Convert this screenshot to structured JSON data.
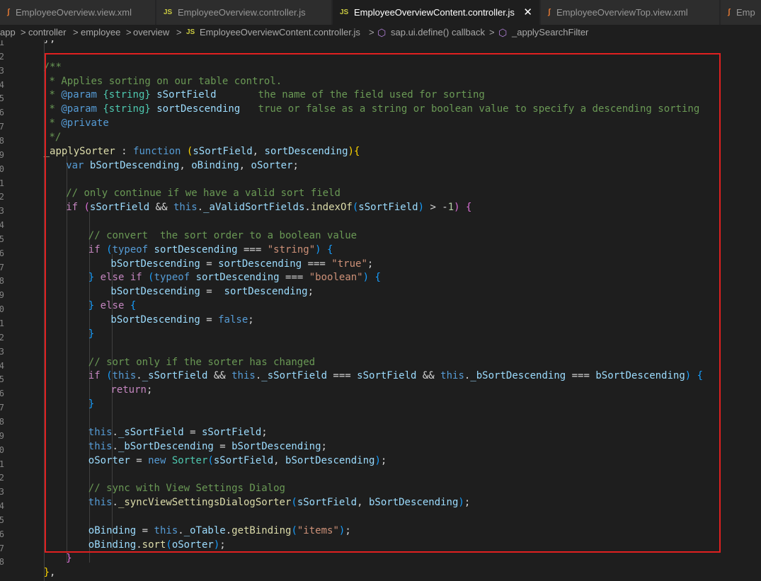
{
  "tabs": [
    {
      "icon": "xml-file-icon",
      "icon_glyph": "ʃ",
      "label": "EmployeeOverview.view.xml",
      "active": false
    },
    {
      "icon": "js-file-icon",
      "icon_glyph": "JS",
      "label": "EmployeeOverview.controller.js",
      "active": false
    },
    {
      "icon": "js-file-icon",
      "icon_glyph": "JS",
      "label": "EmployeeOverviewContent.controller.js",
      "active": true,
      "close": "✕"
    },
    {
      "icon": "xml-file-icon",
      "icon_glyph": "ʃ",
      "label": "EmployeeOverviewTop.view.xml",
      "active": false
    },
    {
      "icon": "xml-file-icon",
      "icon_glyph": "ʃ",
      "label": "Emp",
      "active": false
    }
  ],
  "breadcrumb": {
    "items": [
      "app",
      "controller",
      "employee",
      "overview"
    ],
    "file_badge": "JS",
    "file": "EmployeeOverviewContent.controller.js",
    "scope1": "sap.ui.define() callback",
    "scope2": "_applySearchFilter",
    "separator": ">"
  },
  "gutter": [
    "1",
    "2",
    "3",
    "4",
    "5",
    "6",
    "7",
    "8",
    "9",
    "0",
    "1",
    "2",
    "3",
    "4",
    "5",
    "6",
    "7",
    "8",
    "9",
    "0",
    "1",
    "2",
    "3",
    "4",
    "5",
    "6",
    "7",
    "8",
    "9",
    "0",
    "1",
    "2",
    "3",
    "4",
    "5",
    "6",
    "7",
    "8"
  ],
  "code_lines": [
    {
      "indent": "    ",
      "tokens": [
        [
          "p",
          "};"
        ]
      ]
    },
    {
      "indent": "",
      "tokens": []
    },
    {
      "indent": "    ",
      "tokens": [
        [
          "c",
          "/**"
        ]
      ]
    },
    {
      "indent": "     ",
      "tokens": [
        [
          "c",
          "* Applies sorting on our table control."
        ]
      ]
    },
    {
      "indent": "     ",
      "tokens": [
        [
          "c",
          "* "
        ],
        [
          "dc",
          "@param"
        ],
        [
          "c",
          " "
        ],
        [
          "dt",
          "{string}"
        ],
        [
          "c",
          " "
        ],
        [
          "v",
          "sSortField"
        ],
        [
          "c",
          "       the name of the field used for sorting"
        ]
      ]
    },
    {
      "indent": "     ",
      "tokens": [
        [
          "c",
          "* "
        ],
        [
          "dc",
          "@param"
        ],
        [
          "c",
          " "
        ],
        [
          "dt",
          "{string}"
        ],
        [
          "c",
          " "
        ],
        [
          "v",
          "sortDescending"
        ],
        [
          "c",
          "   true or false as a string or boolean value to specify a descending sorting"
        ]
      ]
    },
    {
      "indent": "     ",
      "tokens": [
        [
          "c",
          "* "
        ],
        [
          "dc",
          "@private"
        ]
      ]
    },
    {
      "indent": "     ",
      "tokens": [
        [
          "c",
          "*/"
        ]
      ]
    },
    {
      "indent": "    ",
      "tokens": [
        [
          "f",
          "_applySorter"
        ],
        [
          "p",
          " : "
        ],
        [
          "k",
          "function"
        ],
        [
          "p",
          " "
        ],
        [
          "b1",
          "("
        ],
        [
          "v",
          "sSortField"
        ],
        [
          "p",
          ", "
        ],
        [
          "v",
          "sortDescending"
        ],
        [
          "b1",
          ")"
        ],
        [
          "b1",
          "{"
        ]
      ]
    },
    {
      "indent": "        ",
      "tokens": [
        [
          "k",
          "var"
        ],
        [
          "p",
          " "
        ],
        [
          "v",
          "bSortDescending"
        ],
        [
          "p",
          ", "
        ],
        [
          "v",
          "oBinding"
        ],
        [
          "p",
          ", "
        ],
        [
          "v",
          "oSorter"
        ],
        [
          "p",
          ";"
        ]
      ]
    },
    {
      "indent": "",
      "tokens": []
    },
    {
      "indent": "        ",
      "tokens": [
        [
          "c",
          "// only continue if we have a valid sort field"
        ]
      ]
    },
    {
      "indent": "        ",
      "tokens": [
        [
          "kc",
          "if"
        ],
        [
          "p",
          " "
        ],
        [
          "b2",
          "("
        ],
        [
          "v",
          "sSortField"
        ],
        [
          "p",
          " && "
        ],
        [
          "k",
          "this"
        ],
        [
          "p",
          "."
        ],
        [
          "v",
          "_aValidSortFields"
        ],
        [
          "p",
          "."
        ],
        [
          "f",
          "indexOf"
        ],
        [
          "b3",
          "("
        ],
        [
          "v",
          "sSortField"
        ],
        [
          "b3",
          ")"
        ],
        [
          "p",
          " > -"
        ],
        [
          "n",
          "1"
        ],
        [
          "b2",
          ")"
        ],
        [
          "p",
          " "
        ],
        [
          "b2",
          "{"
        ]
      ]
    },
    {
      "indent": "",
      "tokens": []
    },
    {
      "indent": "            ",
      "tokens": [
        [
          "c",
          "// convert  the sort order to a boolean value"
        ]
      ]
    },
    {
      "indent": "            ",
      "tokens": [
        [
          "kc",
          "if"
        ],
        [
          "p",
          " "
        ],
        [
          "b3",
          "("
        ],
        [
          "k",
          "typeof"
        ],
        [
          "p",
          " "
        ],
        [
          "v",
          "sortDescending"
        ],
        [
          "p",
          " === "
        ],
        [
          "s",
          "\"string\""
        ],
        [
          "b3",
          ")"
        ],
        [
          "p",
          " "
        ],
        [
          "b3",
          "{"
        ]
      ]
    },
    {
      "indent": "                ",
      "tokens": [
        [
          "v",
          "bSortDescending"
        ],
        [
          "p",
          " = "
        ],
        [
          "v",
          "sortDescending"
        ],
        [
          "p",
          " === "
        ],
        [
          "s",
          "\"true\""
        ],
        [
          "p",
          ";"
        ]
      ]
    },
    {
      "indent": "            ",
      "tokens": [
        [
          "b3",
          "}"
        ],
        [
          "p",
          " "
        ],
        [
          "kc",
          "else"
        ],
        [
          "p",
          " "
        ],
        [
          "kc",
          "if"
        ],
        [
          "p",
          " "
        ],
        [
          "b3",
          "("
        ],
        [
          "k",
          "typeof"
        ],
        [
          "p",
          " "
        ],
        [
          "v",
          "sortDescending"
        ],
        [
          "p",
          " === "
        ],
        [
          "s",
          "\"boolean\""
        ],
        [
          "b3",
          ")"
        ],
        [
          "p",
          " "
        ],
        [
          "b3",
          "{"
        ]
      ]
    },
    {
      "indent": "                ",
      "tokens": [
        [
          "v",
          "bSortDescending"
        ],
        [
          "p",
          " =  "
        ],
        [
          "v",
          "sortDescending"
        ],
        [
          "p",
          ";"
        ]
      ]
    },
    {
      "indent": "            ",
      "tokens": [
        [
          "b3",
          "}"
        ],
        [
          "p",
          " "
        ],
        [
          "kc",
          "else"
        ],
        [
          "p",
          " "
        ],
        [
          "b3",
          "{"
        ]
      ]
    },
    {
      "indent": "                ",
      "tokens": [
        [
          "v",
          "bSortDescending"
        ],
        [
          "p",
          " = "
        ],
        [
          "k",
          "false"
        ],
        [
          "p",
          ";"
        ]
      ]
    },
    {
      "indent": "            ",
      "tokens": [
        [
          "b3",
          "}"
        ]
      ]
    },
    {
      "indent": "",
      "tokens": []
    },
    {
      "indent": "            ",
      "tokens": [
        [
          "c",
          "// sort only if the sorter has changed"
        ]
      ]
    },
    {
      "indent": "            ",
      "tokens": [
        [
          "kc",
          "if"
        ],
        [
          "p",
          " "
        ],
        [
          "b3",
          "("
        ],
        [
          "k",
          "this"
        ],
        [
          "p",
          "."
        ],
        [
          "v",
          "_sSortField"
        ],
        [
          "p",
          " && "
        ],
        [
          "k",
          "this"
        ],
        [
          "p",
          "."
        ],
        [
          "v",
          "_sSortField"
        ],
        [
          "p",
          " === "
        ],
        [
          "v",
          "sSortField"
        ],
        [
          "p",
          " && "
        ],
        [
          "k",
          "this"
        ],
        [
          "p",
          "."
        ],
        [
          "v",
          "_bSortDescending"
        ],
        [
          "p",
          " === "
        ],
        [
          "v",
          "bSortDescending"
        ],
        [
          "b3",
          ")"
        ],
        [
          "p",
          " "
        ],
        [
          "b3",
          "{"
        ]
      ]
    },
    {
      "indent": "                ",
      "tokens": [
        [
          "kc",
          "return"
        ],
        [
          "p",
          ";"
        ]
      ]
    },
    {
      "indent": "            ",
      "tokens": [
        [
          "b3",
          "}"
        ]
      ]
    },
    {
      "indent": "",
      "tokens": []
    },
    {
      "indent": "            ",
      "tokens": [
        [
          "k",
          "this"
        ],
        [
          "p",
          "."
        ],
        [
          "v",
          "_sSortField"
        ],
        [
          "p",
          " = "
        ],
        [
          "v",
          "sSortField"
        ],
        [
          "p",
          ";"
        ]
      ]
    },
    {
      "indent": "            ",
      "tokens": [
        [
          "k",
          "this"
        ],
        [
          "p",
          "."
        ],
        [
          "v",
          "_bSortDescending"
        ],
        [
          "p",
          " = "
        ],
        [
          "v",
          "bSortDescending"
        ],
        [
          "p",
          ";"
        ]
      ]
    },
    {
      "indent": "            ",
      "tokens": [
        [
          "v",
          "oSorter"
        ],
        [
          "p",
          " = "
        ],
        [
          "k",
          "new"
        ],
        [
          "p",
          " "
        ],
        [
          "t",
          "Sorter"
        ],
        [
          "b3",
          "("
        ],
        [
          "v",
          "sSortField"
        ],
        [
          "p",
          ", "
        ],
        [
          "v",
          "bSortDescending"
        ],
        [
          "b3",
          ")"
        ],
        [
          "p",
          ";"
        ]
      ]
    },
    {
      "indent": "",
      "tokens": []
    },
    {
      "indent": "            ",
      "tokens": [
        [
          "c",
          "// sync with View Settings Dialog"
        ]
      ]
    },
    {
      "indent": "            ",
      "tokens": [
        [
          "k",
          "this"
        ],
        [
          "p",
          "."
        ],
        [
          "f",
          "_syncViewSettingsDialogSorter"
        ],
        [
          "b3",
          "("
        ],
        [
          "v",
          "sSortField"
        ],
        [
          "p",
          ", "
        ],
        [
          "v",
          "bSortDescending"
        ],
        [
          "b3",
          ")"
        ],
        [
          "p",
          ";"
        ]
      ]
    },
    {
      "indent": "",
      "tokens": []
    },
    {
      "indent": "            ",
      "tokens": [
        [
          "v",
          "oBinding"
        ],
        [
          "p",
          " = "
        ],
        [
          "k",
          "this"
        ],
        [
          "p",
          "."
        ],
        [
          "v",
          "_oTable"
        ],
        [
          "p",
          "."
        ],
        [
          "f",
          "getBinding"
        ],
        [
          "b3",
          "("
        ],
        [
          "s",
          "\"items\""
        ],
        [
          "b3",
          ")"
        ],
        [
          "p",
          ";"
        ]
      ]
    },
    {
      "indent": "            ",
      "tokens": [
        [
          "v",
          "oBinding"
        ],
        [
          "p",
          "."
        ],
        [
          "f",
          "sort"
        ],
        [
          "b3",
          "("
        ],
        [
          "v",
          "oSorter"
        ],
        [
          "b3",
          ")"
        ],
        [
          "p",
          ";"
        ]
      ]
    },
    {
      "indent": "        ",
      "tokens": [
        [
          "b2",
          "}"
        ]
      ]
    },
    {
      "indent": "    ",
      "tokens": [
        [
          "b1",
          "}"
        ],
        [
          "p",
          ","
        ]
      ]
    }
  ]
}
